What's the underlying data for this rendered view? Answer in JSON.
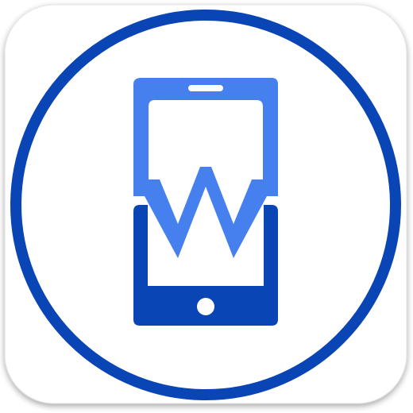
{
  "icon": {
    "name": "mobile-w-app-icon",
    "glyph": "phone-with-w-icon",
    "letter": "W"
  },
  "colors": {
    "tile": "#ffffff",
    "tile_shadow": "#cfcfcf",
    "ring": "#0a45b5",
    "phone_top": "#4680ee",
    "phone_bottom": "#0a45b5",
    "screen": "#ffffff",
    "button": "#ffffff"
  }
}
